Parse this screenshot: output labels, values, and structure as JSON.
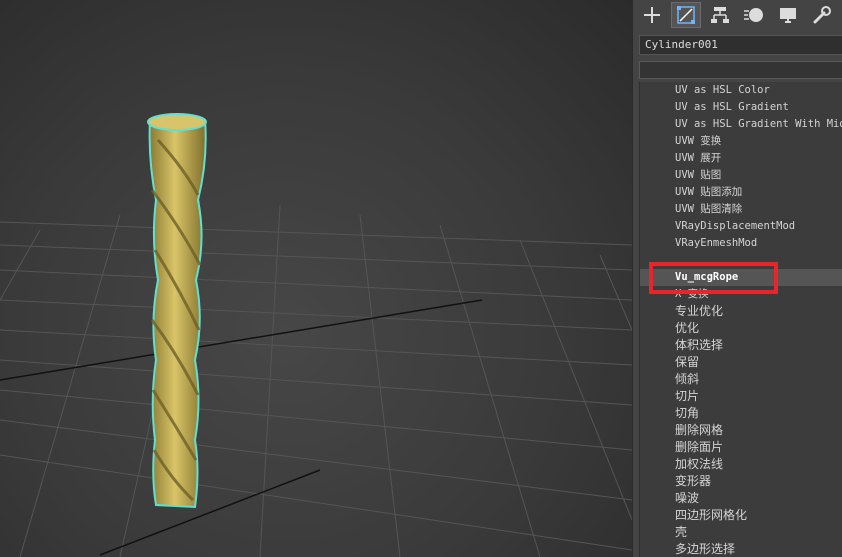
{
  "command_panel": {
    "tabs": [
      {
        "icon": "plus-create-icon",
        "active": false
      },
      {
        "icon": "modify-icon",
        "active": true
      },
      {
        "icon": "hierarchy-icon",
        "active": false
      },
      {
        "icon": "motion-icon",
        "active": false
      },
      {
        "icon": "display-icon",
        "active": false
      },
      {
        "icon": "utilities-wrench-icon",
        "active": false
      }
    ],
    "object_name": "Cylinder001",
    "modifier_list_value": "",
    "modifiers": [
      "UV as HSL Color",
      "UV as HSL Gradient",
      "UV as HSL Gradient With Midp",
      "UVW 变换",
      "UVW 展开",
      "UVW 贴图",
      "UVW 贴图添加",
      "UVW 贴图清除",
      "VRayDisplacementMod",
      "VRayEnmeshMod",
      "",
      "Vu_mcgRope",
      "X 变换",
      "专业优化",
      "优化",
      "体积选择",
      "保留",
      "倾斜",
      "切片",
      "切角",
      "删除网格",
      "删除面片",
      "加权法线",
      "变形器",
      "噪波",
      "四边形网格化",
      "壳",
      "多边形选择"
    ],
    "selected_index": 11
  },
  "colors": {
    "rope": "#c8b45a",
    "selection_outline": "#5fe0d2",
    "highlight": "#e8252b"
  }
}
